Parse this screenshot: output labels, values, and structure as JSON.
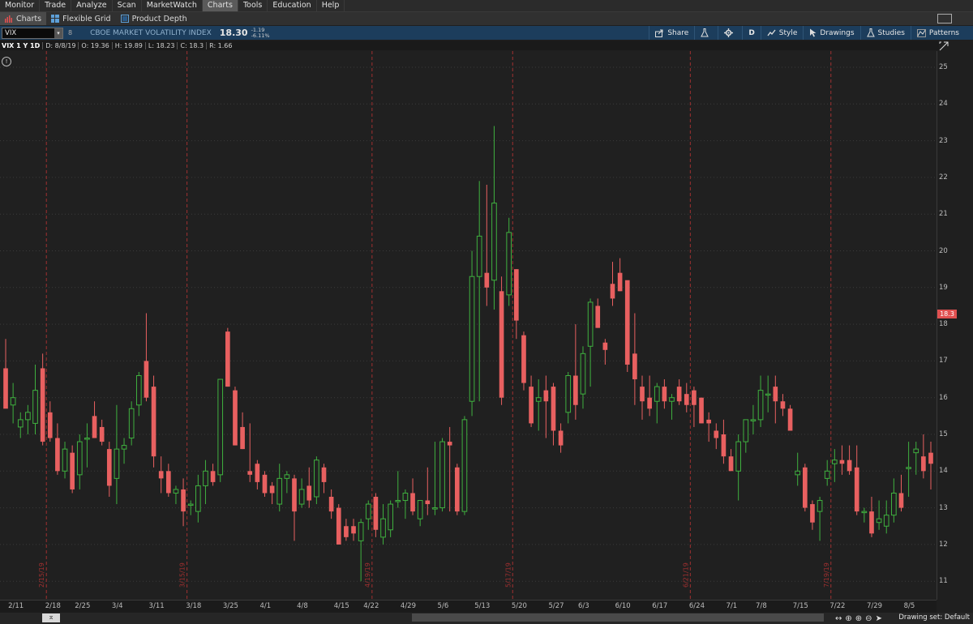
{
  "menu": [
    "Monitor",
    "Trade",
    "Analyze",
    "Scan",
    "MarketWatch",
    "Charts",
    "Tools",
    "Education",
    "Help"
  ],
  "menu_active": "Charts",
  "subtabs": [
    "Charts",
    "Flexible Grid",
    "Product Depth"
  ],
  "toolbar": {
    "symbol": "VIX",
    "description": "CBOE MARKET VOLATILITY INDEX",
    "price": "18.30",
    "change": "-1.19",
    "change_pct": "-6.11%",
    "share": "Share",
    "aggregation": "D",
    "style": "Style",
    "drawings": "Drawings",
    "studies": "Studies",
    "patterns": "Patterns"
  },
  "infobar": {
    "title": "VIX 1 Y 1D",
    "date": "D: 8/8/19",
    "open": "O: 19.36",
    "high": "H: 19.89",
    "low": "L: 18.23",
    "close": "C: 18.3",
    "range": "R: 1.66"
  },
  "price_tag": "18.3",
  "colors": {
    "up": "#3fb03f",
    "down": "#e86060",
    "grid_marker": "#a03030",
    "toolbar_bg": "#1c3d5c"
  },
  "footer": {
    "drawing_set": "Drawing set: Default"
  },
  "chart_data": {
    "type": "candlestick",
    "ylim": [
      11,
      25
    ],
    "y_ticks": [
      11,
      12,
      13,
      14,
      15,
      16,
      17,
      18,
      19,
      20,
      21,
      22,
      23,
      24,
      25
    ],
    "x_ticks": [
      "2/11",
      "2/18",
      "2/25",
      "3/4",
      "3/11",
      "3/18",
      "3/25",
      "4/1",
      "4/8",
      "4/15",
      "4/22",
      "4/29",
      "5/6",
      "5/13",
      "5/20",
      "5/27",
      "6/3",
      "6/10",
      "6/17",
      "6/24",
      "7/1",
      "7/8",
      "7/15",
      "7/22",
      "7/29",
      "8/5"
    ],
    "month_markers": [
      "2/15/19",
      "3/15/19",
      "4/19/19",
      "5/17/19",
      "6/21/19",
      "7/19/19"
    ],
    "candles": [
      {
        "d": "2/8",
        "o": 16.8,
        "h": 17.6,
        "l": 15.8,
        "c": 15.7
      },
      {
        "d": "2/11",
        "o": 15.8,
        "h": 16.4,
        "l": 15.3,
        "c": 16.0
      },
      {
        "d": "2/12",
        "o": 15.2,
        "h": 15.6,
        "l": 14.9,
        "c": 15.4
      },
      {
        "d": "2/13",
        "o": 15.4,
        "h": 15.8,
        "l": 15.0,
        "c": 15.6
      },
      {
        "d": "2/14",
        "o": 15.3,
        "h": 16.9,
        "l": 15.0,
        "c": 16.2
      },
      {
        "d": "2/15",
        "o": 16.8,
        "h": 17.2,
        "l": 14.7,
        "c": 14.8
      },
      {
        "d": "2/19",
        "o": 15.6,
        "h": 15.9,
        "l": 14.8,
        "c": 14.9
      },
      {
        "d": "2/20",
        "o": 14.9,
        "h": 15.3,
        "l": 13.9,
        "c": 14.0
      },
      {
        "d": "2/21",
        "o": 14.0,
        "h": 14.8,
        "l": 13.8,
        "c": 14.6
      },
      {
        "d": "2/22",
        "o": 14.5,
        "h": 14.7,
        "l": 13.4,
        "c": 13.5
      },
      {
        "d": "2/25",
        "o": 13.9,
        "h": 15.0,
        "l": 13.5,
        "c": 14.8
      },
      {
        "d": "2/26",
        "o": 14.9,
        "h": 15.3,
        "l": 14.1,
        "c": 14.9
      },
      {
        "d": "2/27",
        "o": 15.5,
        "h": 15.9,
        "l": 14.9,
        "c": 14.9
      },
      {
        "d": "2/28",
        "o": 15.2,
        "h": 15.4,
        "l": 14.7,
        "c": 14.8
      },
      {
        "d": "3/1",
        "o": 14.6,
        "h": 14.8,
        "l": 13.3,
        "c": 13.6
      },
      {
        "d": "3/4",
        "o": 13.8,
        "h": 15.8,
        "l": 13.1,
        "c": 14.6
      },
      {
        "d": "3/5",
        "o": 14.6,
        "h": 14.9,
        "l": 14.2,
        "c": 14.7
      },
      {
        "d": "3/6",
        "o": 14.9,
        "h": 15.9,
        "l": 14.7,
        "c": 15.7
      },
      {
        "d": "3/7",
        "o": 15.8,
        "h": 16.7,
        "l": 15.5,
        "c": 16.6
      },
      {
        "d": "3/8",
        "o": 17.0,
        "h": 18.3,
        "l": 15.9,
        "c": 16.0
      },
      {
        "d": "3/11",
        "o": 16.3,
        "h": 16.6,
        "l": 14.1,
        "c": 14.4
      },
      {
        "d": "3/12",
        "o": 14.0,
        "h": 14.4,
        "l": 13.4,
        "c": 13.8
      },
      {
        "d": "3/13",
        "o": 14.0,
        "h": 14.2,
        "l": 13.3,
        "c": 13.4
      },
      {
        "d": "3/14",
        "o": 13.4,
        "h": 13.6,
        "l": 13.1,
        "c": 13.5
      },
      {
        "d": "3/15",
        "o": 13.5,
        "h": 13.8,
        "l": 12.5,
        "c": 12.9
      },
      {
        "d": "3/18",
        "o": 13.1,
        "h": 13.2,
        "l": 12.8,
        "c": 13.1
      },
      {
        "d": "3/19",
        "o": 12.9,
        "h": 13.9,
        "l": 12.6,
        "c": 13.6
      },
      {
        "d": "3/20",
        "o": 13.6,
        "h": 14.3,
        "l": 13.1,
        "c": 14.0
      },
      {
        "d": "3/21",
        "o": 14.0,
        "h": 14.2,
        "l": 13.6,
        "c": 13.7
      },
      {
        "d": "3/22",
        "o": 13.9,
        "h": 16.5,
        "l": 13.7,
        "c": 16.5
      },
      {
        "d": "3/25",
        "o": 17.8,
        "h": 17.9,
        "l": 16.3,
        "c": 16.3
      },
      {
        "d": "3/26",
        "o": 16.2,
        "h": 16.3,
        "l": 14.7,
        "c": 14.7
      },
      {
        "d": "3/27",
        "o": 15.2,
        "h": 15.6,
        "l": 14.6,
        "c": 14.6
      },
      {
        "d": "3/28",
        "o": 14.0,
        "h": 15.3,
        "l": 13.7,
        "c": 13.9
      },
      {
        "d": "3/29",
        "o": 14.2,
        "h": 14.3,
        "l": 13.5,
        "c": 13.7
      },
      {
        "d": "4/1",
        "o": 13.9,
        "h": 14.0,
        "l": 13.3,
        "c": 13.4
      },
      {
        "d": "4/2",
        "o": 13.6,
        "h": 13.7,
        "l": 13.1,
        "c": 13.4
      },
      {
        "d": "4/3",
        "o": 13.1,
        "h": 14.2,
        "l": 12.9,
        "c": 13.8
      },
      {
        "d": "4/4",
        "o": 13.8,
        "h": 14.0,
        "l": 13.4,
        "c": 13.9
      },
      {
        "d": "4/5",
        "o": 13.8,
        "h": 13.9,
        "l": 12.1,
        "c": 12.9
      },
      {
        "d": "4/8",
        "o": 13.1,
        "h": 13.8,
        "l": 13.0,
        "c": 13.5
      },
      {
        "d": "4/9",
        "o": 13.6,
        "h": 14.1,
        "l": 13.0,
        "c": 13.2
      },
      {
        "d": "4/10",
        "o": 13.3,
        "h": 14.4,
        "l": 13.1,
        "c": 14.3
      },
      {
        "d": "4/11",
        "o": 14.1,
        "h": 14.2,
        "l": 13.4,
        "c": 13.7
      },
      {
        "d": "4/12",
        "o": 13.3,
        "h": 13.5,
        "l": 12.7,
        "c": 12.9
      },
      {
        "d": "4/15",
        "o": 13.0,
        "h": 13.1,
        "l": 12.0,
        "c": 12.0
      },
      {
        "d": "4/16",
        "o": 12.5,
        "h": 12.7,
        "l": 12.1,
        "c": 12.2
      },
      {
        "d": "4/17",
        "o": 12.5,
        "h": 12.7,
        "l": 12.1,
        "c": 12.3
      },
      {
        "d": "4/18",
        "o": 12.1,
        "h": 12.7,
        "l": 11.0,
        "c": 12.6
      },
      {
        "d": "4/22",
        "o": 12.7,
        "h": 13.2,
        "l": 12.4,
        "c": 13.1
      },
      {
        "d": "4/23",
        "o": 13.3,
        "h": 13.4,
        "l": 12.2,
        "c": 12.4
      },
      {
        "d": "4/24",
        "o": 12.2,
        "h": 13.1,
        "l": 12.0,
        "c": 12.7
      },
      {
        "d": "4/25",
        "o": 12.4,
        "h": 13.2,
        "l": 12.2,
        "c": 13.1
      },
      {
        "d": "4/26",
        "o": 13.2,
        "h": 14.0,
        "l": 13.0,
        "c": 13.2
      },
      {
        "d": "4/29",
        "o": 13.2,
        "h": 13.5,
        "l": 12.7,
        "c": 13.4
      },
      {
        "d": "4/30",
        "o": 13.4,
        "h": 13.8,
        "l": 12.8,
        "c": 12.9
      },
      {
        "d": "5/1",
        "o": 12.7,
        "h": 13.2,
        "l": 12.5,
        "c": 13.2
      },
      {
        "d": "5/2",
        "o": 13.2,
        "h": 14.1,
        "l": 12.8,
        "c": 13.1
      },
      {
        "d": "5/3",
        "o": 13.0,
        "h": 14.8,
        "l": 12.8,
        "c": 13.0
      },
      {
        "d": "5/6",
        "o": 13.0,
        "h": 14.9,
        "l": 12.9,
        "c": 14.8
      },
      {
        "d": "5/7",
        "o": 14.8,
        "h": 15.2,
        "l": 12.9,
        "c": 14.7
      },
      {
        "d": "5/8",
        "o": 14.1,
        "h": 14.2,
        "l": 12.8,
        "c": 12.9
      },
      {
        "d": "5/9",
        "o": 12.9,
        "h": 15.5,
        "l": 12.8,
        "c": 15.4
      },
      {
        "d": "5/10",
        "o": 15.9,
        "h": 20.0,
        "l": 15.5,
        "c": 19.3
      },
      {
        "d": "5/13",
        "o": 19.3,
        "h": 21.9,
        "l": 15.9,
        "c": 20.4
      },
      {
        "d": "5/14",
        "o": 19.4,
        "h": 21.8,
        "l": 18.5,
        "c": 19.0
      },
      {
        "d": "5/15",
        "o": 19.2,
        "h": 23.4,
        "l": 18.4,
        "c": 21.3
      },
      {
        "d": "5/16",
        "o": 18.9,
        "h": 19.3,
        "l": 15.8,
        "c": 16.0
      },
      {
        "d": "5/17",
        "o": 18.8,
        "h": 20.9,
        "l": 18.5,
        "c": 20.5
      },
      {
        "d": "5/20",
        "o": 19.5,
        "h": 19.5,
        "l": 17.6,
        "c": 18.1
      },
      {
        "d": "5/21",
        "o": 17.7,
        "h": 17.8,
        "l": 16.2,
        "c": 16.4
      },
      {
        "d": "5/22",
        "o": 16.3,
        "h": 16.6,
        "l": 15.2,
        "c": 15.3
      },
      {
        "d": "5/23",
        "o": 15.9,
        "h": 16.5,
        "l": 15.1,
        "c": 16.0
      },
      {
        "d": "5/24",
        "o": 16.2,
        "h": 16.6,
        "l": 14.9,
        "c": 15.9
      },
      {
        "d": "5/28",
        "o": 16.3,
        "h": 16.4,
        "l": 14.7,
        "c": 15.1
      },
      {
        "d": "5/29",
        "o": 15.1,
        "h": 15.3,
        "l": 14.5,
        "c": 14.7
      },
      {
        "d": "5/30",
        "o": 15.6,
        "h": 16.7,
        "l": 15.3,
        "c": 16.6
      },
      {
        "d": "5/31",
        "o": 16.6,
        "h": 18.0,
        "l": 15.4,
        "c": 15.8
      },
      {
        "d": "6/3",
        "o": 16.1,
        "h": 17.4,
        "l": 15.7,
        "c": 17.2
      },
      {
        "d": "6/4",
        "o": 17.4,
        "h": 18.7,
        "l": 16.3,
        "c": 18.6
      },
      {
        "d": "6/5",
        "o": 18.5,
        "h": 18.7,
        "l": 17.9,
        "c": 17.9
      },
      {
        "d": "6/6",
        "o": 17.5,
        "h": 17.6,
        "l": 16.9,
        "c": 17.3
      },
      {
        "d": "6/7",
        "o": 19.1,
        "h": 19.7,
        "l": 18.5,
        "c": 18.7
      },
      {
        "d": "6/10",
        "o": 19.4,
        "h": 19.8,
        "l": 18.9,
        "c": 18.9
      },
      {
        "d": "6/11",
        "o": 19.2,
        "h": 18.9,
        "l": 16.7,
        "c": 16.9
      },
      {
        "d": "6/12",
        "o": 17.2,
        "h": 18.3,
        "l": 15.8,
        "c": 16.5
      },
      {
        "d": "6/13",
        "o": 16.3,
        "h": 16.6,
        "l": 15.4,
        "c": 15.9
      },
      {
        "d": "6/14",
        "o": 16.0,
        "h": 16.6,
        "l": 15.5,
        "c": 15.7
      },
      {
        "d": "6/17",
        "o": 15.9,
        "h": 16.4,
        "l": 15.3,
        "c": 16.3
      },
      {
        "d": "6/18",
        "o": 16.3,
        "h": 16.5,
        "l": 15.7,
        "c": 15.9
      },
      {
        "d": "6/19",
        "o": 15.9,
        "h": 16.1,
        "l": 15.4,
        "c": 16.0
      },
      {
        "d": "6/20",
        "o": 16.3,
        "h": 16.5,
        "l": 15.8,
        "c": 15.9
      },
      {
        "d": "6/21",
        "o": 16.1,
        "h": 16.4,
        "l": 15.6,
        "c": 15.8
      },
      {
        "d": "6/24",
        "o": 16.2,
        "h": 16.3,
        "l": 15.2,
        "c": 15.8
      },
      {
        "d": "6/25",
        "o": 16.0,
        "h": 16.0,
        "l": 15.3,
        "c": 15.3
      },
      {
        "d": "6/26",
        "o": 15.4,
        "h": 15.6,
        "l": 14.8,
        "c": 15.3
      },
      {
        "d": "6/27",
        "o": 15.1,
        "h": 15.3,
        "l": 14.6,
        "c": 14.9
      },
      {
        "d": "6/28",
        "o": 15.0,
        "h": 15.4,
        "l": 14.2,
        "c": 14.4
      },
      {
        "d": "7/1",
        "o": 14.4,
        "h": 14.6,
        "l": 14.1,
        "c": 14.0
      },
      {
        "d": "7/2",
        "o": 14.0,
        "h": 15.0,
        "l": 13.2,
        "c": 14.8
      },
      {
        "d": "7/3",
        "o": 14.8,
        "h": 15.4,
        "l": 14.5,
        "c": 15.4
      },
      {
        "d": "7/5",
        "o": 15.4,
        "h": 15.8,
        "l": 15.0,
        "c": 15.4
      },
      {
        "d": "7/8",
        "o": 15.4,
        "h": 16.6,
        "l": 15.2,
        "c": 16.2
      },
      {
        "d": "7/9",
        "o": 16.1,
        "h": 16.6,
        "l": 15.6,
        "c": 16.1
      },
      {
        "d": "7/10",
        "o": 16.3,
        "h": 16.6,
        "l": 15.3,
        "c": 15.9
      },
      {
        "d": "7/11",
        "o": 15.9,
        "h": 16.1,
        "l": 15.5,
        "c": 15.7
      },
      {
        "d": "7/12",
        "o": 15.7,
        "h": 15.8,
        "l": 15.1,
        "c": 15.1
      },
      {
        "d": "7/15",
        "o": 13.9,
        "h": 14.5,
        "l": 13.6,
        "c": 14.0
      },
      {
        "d": "7/16",
        "o": 14.1,
        "h": 14.2,
        "l": 12.9,
        "c": 13.0
      },
      {
        "d": "7/17",
        "o": 13.1,
        "h": 13.2,
        "l": 12.4,
        "c": 12.6
      },
      {
        "d": "7/18",
        "o": 12.9,
        "h": 13.3,
        "l": 12.1,
        "c": 13.2
      },
      {
        "d": "7/19",
        "o": 13.8,
        "h": 14.3,
        "l": 13.6,
        "c": 14.0
      },
      {
        "d": "7/22",
        "o": 14.2,
        "h": 14.6,
        "l": 13.7,
        "c": 14.3
      },
      {
        "d": "7/23",
        "o": 14.3,
        "h": 14.7,
        "l": 13.9,
        "c": 14.2
      },
      {
        "d": "7/24",
        "o": 14.3,
        "h": 14.7,
        "l": 13.9,
        "c": 14.0
      },
      {
        "d": "7/25",
        "o": 14.1,
        "h": 14.7,
        "l": 12.8,
        "c": 12.9
      },
      {
        "d": "7/26",
        "o": 12.9,
        "h": 13.0,
        "l": 12.6,
        "c": 12.9
      },
      {
        "d": "7/29",
        "o": 12.9,
        "h": 13.3,
        "l": 12.2,
        "c": 12.3
      },
      {
        "d": "7/30",
        "o": 12.6,
        "h": 13.2,
        "l": 12.4,
        "c": 12.7
      },
      {
        "d": "7/31",
        "o": 12.5,
        "h": 13.2,
        "l": 12.3,
        "c": 12.8
      },
      {
        "d": "8/1",
        "o": 12.8,
        "h": 13.8,
        "l": 12.6,
        "c": 13.4
      },
      {
        "d": "8/2",
        "o": 13.4,
        "h": 13.9,
        "l": 12.9,
        "c": 13.0
      },
      {
        "d": "8/5",
        "o": 14.1,
        "h": 14.8,
        "l": 13.3,
        "c": 14.1
      },
      {
        "d": "8/6",
        "o": 14.5,
        "h": 14.8,
        "l": 13.9,
        "c": 14.6
      },
      {
        "d": "8/7",
        "o": 14.4,
        "h": 15.0,
        "l": 13.8,
        "c": 14.0
      },
      {
        "d": "8/8",
        "o": 14.5,
        "h": 14.8,
        "l": 13.5,
        "c": 14.2
      }
    ]
  }
}
